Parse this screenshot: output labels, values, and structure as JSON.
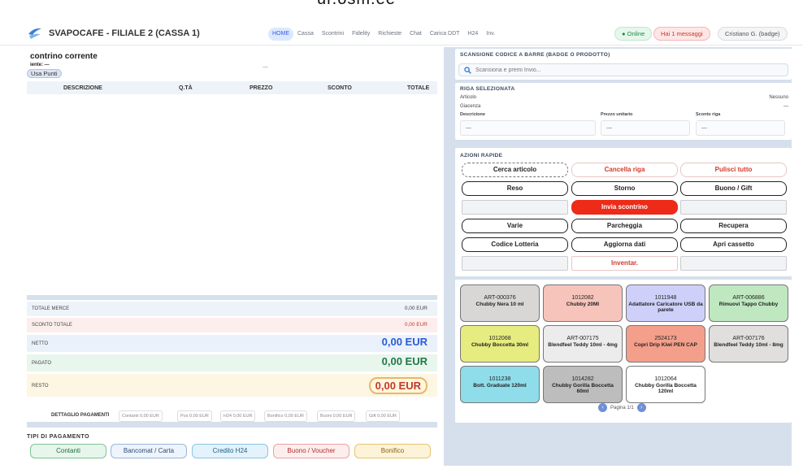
{
  "top": {
    "title": "ur.osm.ee"
  },
  "header": {
    "brand": "SVAPOCAFE - FILIALE 2 (CASSA 1)",
    "nav": [
      "HOME",
      "Cassa",
      "Scontrini",
      "Fidelity",
      "Richieste",
      "Chat",
      "Carica DDT",
      "H24",
      "Inv."
    ],
    "online": "● Online",
    "messages": "Hai 1 messaggi",
    "user": "Cristiano G. (badge)"
  },
  "receipt": {
    "title": "contrino corrente",
    "client": "iente: —",
    "dash": "—",
    "use_points": "Usa Punti",
    "columns": {
      "desc": "DESCRIZIONE",
      "qty": "Q.TÀ",
      "price": "PREZZO",
      "discount": "SCONTO",
      "total": "TOTALE"
    }
  },
  "totals": {
    "merce_label": "TOTALE MERCE",
    "merce": "0,00 EUR",
    "sconto_label": "SCONTO TOTALE",
    "sconto": "0,00 EUR",
    "netto_label": "NETTO",
    "netto": "0,00 EUR",
    "pagato_label": "PAGATO",
    "pagato": "0,00 EUR",
    "resto_label": "RESTO",
    "resto": "0,00 EUR",
    "details_label": "DETTAGLIO PAGAMENTI",
    "details": [
      "Contanti 0,00 EUR",
      "Pos 0,00 EUR",
      "H24 0,00 EUR",
      "Bonifico 0,00 EUR",
      "Buoni 0,00 EUR",
      "Gift 0,00 EUR"
    ]
  },
  "payment": {
    "title": "TIPI DI PAGAMENTO",
    "buttons": [
      "Contanti",
      "Bancomat / Carta",
      "Credito H24",
      "Buono / Voucher",
      "Bonifico"
    ]
  },
  "scan": {
    "title": "SCANSIONE CODICE A BARRE (BADGE O PRODOTTO)",
    "placeholder": "Scansiona e premi Invio..."
  },
  "selected": {
    "title": "RIGA SELEZIONATA",
    "articolo_label": "Articolo",
    "articolo": "Nessuno",
    "giacenza_label": "Giacenza",
    "giacenza": "—",
    "descr_label": "Descrizione",
    "unit_label": "Prezzo unitario",
    "sconto_label": "Sconto riga",
    "descr": "—",
    "unit": "—",
    "sconto": "—"
  },
  "quick": {
    "title": "AZIONI RAPIDE",
    "rows": [
      [
        "Cerca articolo",
        "Cancella riga",
        "Pulisci tutto"
      ],
      [
        "Reso",
        "Storno",
        "Buono / Gift"
      ],
      [
        "",
        "Invia scontrino",
        ""
      ],
      [
        "Varie",
        "Parcheggia",
        "Recupera"
      ],
      [
        "Codice Lotteria",
        "Aggiorna dati",
        "Apri cassetto"
      ],
      [
        "",
        "Inventar.",
        ""
      ]
    ]
  },
  "products": [
    {
      "code": "ART-000376",
      "name": "Chubby Nera 10 ml",
      "color": "#d9d6d6"
    },
    {
      "code": "1012082",
      "name": "Chubby 20Ml",
      "color": "#f7c4bb"
    },
    {
      "code": "1011948",
      "name": "Adattatore Caricatore USB da parete",
      "color": "#cfd0fa"
    },
    {
      "code": "ART-006886",
      "name": "Rimuovi Tappo Chubby",
      "color": "#bfe8c0"
    },
    {
      "code": "1012068",
      "name": "Chubby Boccetta 30ml",
      "color": "#e6ec7f"
    },
    {
      "code": "ART-007175",
      "name": "Blendfeel Teddy 10ml - 4mg",
      "color": "#ececec"
    },
    {
      "code": "2524173",
      "name": "Copri Drip Kiwi PEN CAP",
      "color": "#f49f8b"
    },
    {
      "code": "ART-007176",
      "name": "Blendfeel Teddy 10ml - 8mg",
      "color": "#e1dede"
    },
    {
      "code": "1011238",
      "name": "Bott. Graduate 120ml",
      "color": "#8fdcea"
    },
    {
      "code": "1014282",
      "name": "Chubby Gorilla Boccetta 60ml",
      "color": "#bdbdbd"
    },
    {
      "code": "1012064",
      "name": "Chubby Gorilla Boccetta 120ml",
      "color": "#ffffff"
    }
  ],
  "pager": {
    "label": "Pagina 1/1"
  }
}
